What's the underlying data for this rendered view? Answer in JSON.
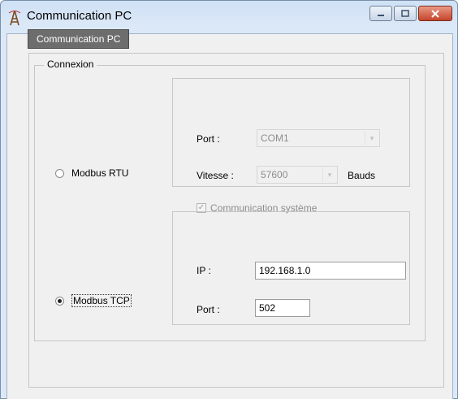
{
  "window": {
    "title": "Communication PC",
    "icons": {
      "app": "tower-icon",
      "minimize": "minimize-icon",
      "maximize": "maximize-icon",
      "close": "close-icon"
    }
  },
  "tab": {
    "label": "Communication PC"
  },
  "connexion": {
    "title": "Connexion",
    "modbus_rtu": {
      "label": "Modbus RTU",
      "selected": false,
      "port_label": "Port :",
      "port_value": "COM1",
      "speed_label": "Vitesse :",
      "speed_value": "57600",
      "speed_unit": "Bauds",
      "system_comm_label": "Communication système",
      "system_comm_checked": true
    },
    "modbus_tcp": {
      "label": "Modbus TCP",
      "selected": true,
      "ip_label": "IP :",
      "ip_value": "192.168.1.0",
      "port_label": "Port :",
      "port_value": "502"
    }
  }
}
